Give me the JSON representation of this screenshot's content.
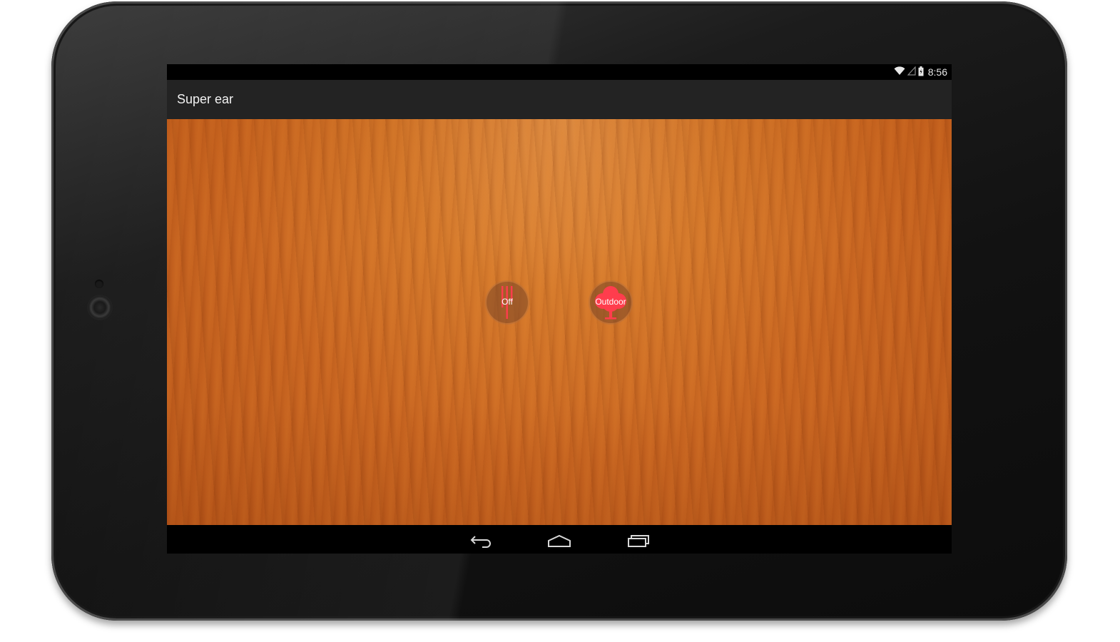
{
  "status_bar": {
    "time": "8:56",
    "icons": [
      "wifi-icon",
      "signal-icon",
      "battery-icon"
    ]
  },
  "action_bar": {
    "title": "Super ear"
  },
  "controls": [
    {
      "label": "Off",
      "icon": "equalizer-icon"
    },
    {
      "label": "Outdoor",
      "icon": "tree-icon"
    }
  ],
  "navigation": {
    "buttons": [
      "back-icon",
      "home-icon",
      "recent-apps-icon"
    ]
  },
  "colors": {
    "accent": "#ff3d4d",
    "action_bar": "#232323",
    "status_bar": "#000000",
    "nav_bar": "#000000"
  }
}
